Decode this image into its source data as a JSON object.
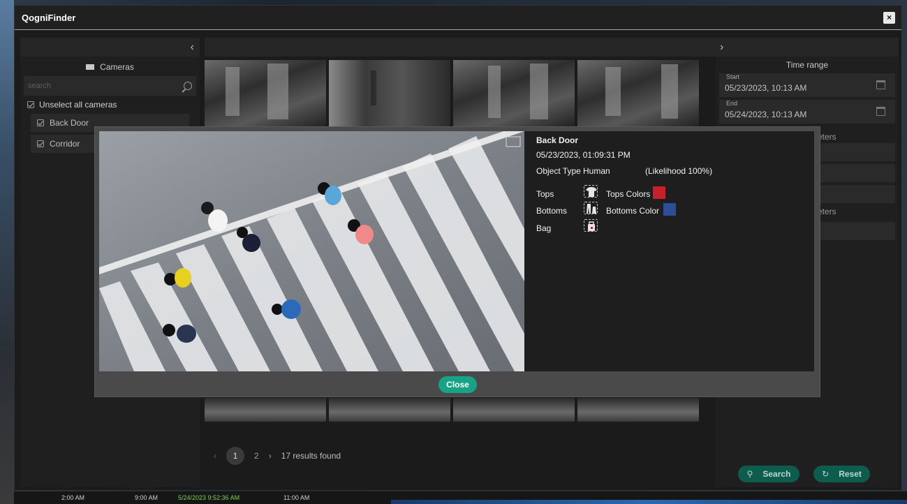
{
  "app": {
    "title": "QogniFinder",
    "close_glyph": "×"
  },
  "nav": {
    "collapse_left": "‹",
    "expand_right": "›"
  },
  "cameras": {
    "header": "Cameras",
    "search_placeholder": "search",
    "unselect_label": "Unselect all cameras",
    "items": [
      {
        "label": "Back Door"
      },
      {
        "label": "Corridor"
      }
    ]
  },
  "time_range": {
    "title": "Time range",
    "start_label": "Start",
    "start_value": "05/23/2023, 10:13 AM",
    "end_label": "End",
    "end_value": "05/24/2023, 10:13 AM"
  },
  "right_sections": {
    "section1_fragment": "eters",
    "section2_fragment": "eters"
  },
  "pager": {
    "prev": "‹",
    "pages": [
      "1",
      "2"
    ],
    "next": "›",
    "results": "17 results found"
  },
  "actions": {
    "search_label": "Search",
    "reset_label": "Reset"
  },
  "detail": {
    "camera": "Back Door",
    "timestamp": "05/23/2023, 01:09:31 PM",
    "object_type_label": "Object Type",
    "object_type_value": "Human",
    "likelihood": "(Likelihood 100%)",
    "tops_label": "Tops",
    "tops_colors_label": "Tops Colors",
    "tops_color": "#c8202a",
    "bottoms_label": "Bottoms",
    "bottoms_color_label": "Bottoms Color",
    "bottoms_color": "#2e4e9a",
    "bag_label": "Bag",
    "icons": {
      "tops": "shirt-icon",
      "bottoms": "pants-icon",
      "bag": "bag-icon"
    },
    "close_label": "Close"
  },
  "timeline": {
    "labels": [
      "2:00 AM",
      "9:00 AM",
      "5/24/2023 9:52:36 AM",
      "11:00 AM"
    ],
    "highlight_color": "#7bd34e"
  },
  "colors": {
    "accent": "#16a386",
    "button_dark": "#0e5c4e"
  }
}
